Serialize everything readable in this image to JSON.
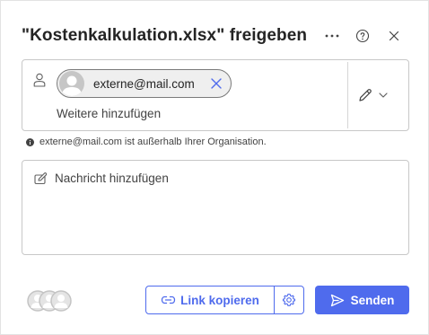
{
  "dialog": {
    "title": "\"Kostenkalkulation.xlsx\" freigeben",
    "more_icon": "more-horizontal-icon",
    "help_icon": "help-icon",
    "close_icon": "close-icon"
  },
  "recipients": {
    "chips": [
      {
        "label": "externe@mail.com"
      }
    ],
    "add_placeholder": "Weitere hinzufügen",
    "permission_icon": "pencil-icon"
  },
  "info": {
    "text": "externe@mail.com ist außerhalb Ihrer Organisation."
  },
  "message": {
    "placeholder": "Nachricht hinzufügen"
  },
  "footer": {
    "copy_link_label": "Link kopieren",
    "send_label": "Senden"
  },
  "colors": {
    "accent": "#4f6bed",
    "text": "#242424",
    "border": "#c8c8c8"
  }
}
